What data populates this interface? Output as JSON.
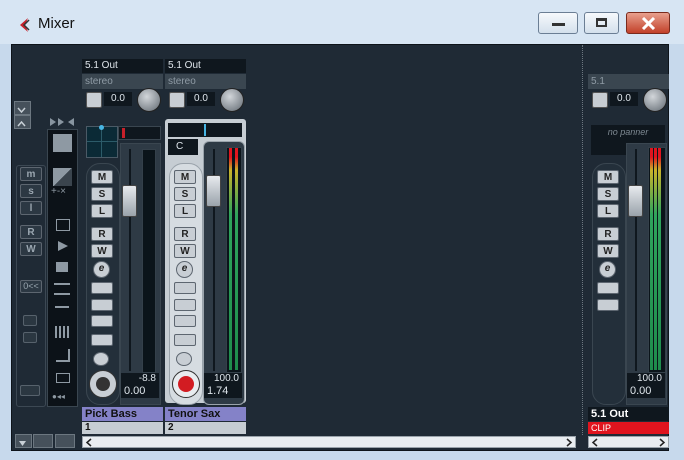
{
  "window": {
    "title": "Mixer"
  },
  "left_panel": {
    "view_labels": [
      "m",
      "s",
      "l",
      "R",
      "W"
    ],
    "zero_label": "0<<"
  },
  "channels": [
    {
      "output": "5.1 Out",
      "format": "stereo",
      "phase_value": "0.0",
      "fader_db_peak": "-8.8",
      "fader_value": "0.00",
      "name": "Pick Bass",
      "number": "1",
      "pan": ""
    },
    {
      "output": "5.1 Out",
      "format": "stereo",
      "phase_value": "0.0",
      "fader_db_peak": "100.0",
      "fader_value": "1.74",
      "name": "Tenor Sax",
      "number": "2",
      "pan": "C"
    }
  ],
  "master": {
    "format": "5.1",
    "phase_value": "0.0",
    "panner": "no panner",
    "fader_db_peak": "100.0",
    "fader_value": "0.00",
    "name": "5.1 Out",
    "clip_label": "CLIP"
  },
  "strip_buttons": {
    "mute": "M",
    "solo": "S",
    "listen": "L",
    "read": "R",
    "write": "W",
    "edit": "e"
  },
  "colors": {
    "channel_name_bg": "#8482c8",
    "selected_strip": "#c6cdd3",
    "clip_red": "#e0141e",
    "record_red": "#d21c22",
    "meter_green": "#1e8c4c"
  }
}
